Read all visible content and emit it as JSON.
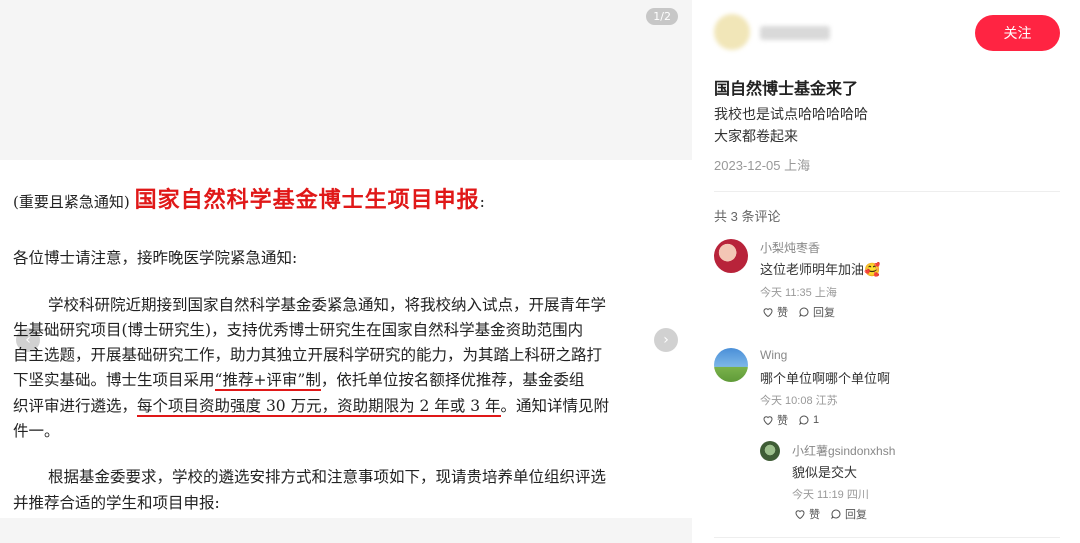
{
  "image_viewer": {
    "page_counter": "1/2",
    "prev_arrow": "‹",
    "next_arrow": "›"
  },
  "document": {
    "title_prefix": "(重要且紧急通知)",
    "title_main": "国家自然科学基金博士生项目申报",
    "title_suffix": ":",
    "greeting": "各位博士请注意，接昨晚医学院紧急通知:",
    "p1_line1": "学校科研院近期接到国家自然科学基金委紧急通知，将我校纳入试点，开展青年学",
    "p1_line2": "生基础研究项目(博士研究生)，支持优秀博士研究生在国家自然科学基金资助范围内",
    "p1_line3": "自主选题，开展基础研究工作，助力其独立开展科学研究的能力，为其踏上科研之路打",
    "p1_line4_a": "下坚实基础。博士生项目采用",
    "p1_line4_b": "“推荐+评审”制",
    "p1_line4_c": "，依托单位按名额择优推荐，基金委组",
    "p1_line5_a": "织评审进行遴选，",
    "p1_line5_b": "每个项目资助强度 30 万元，资助期限为 2 年或 3 年",
    "p1_line5_c": "。通知详情见附",
    "p1_line6": "件一。",
    "p2_line1": "根据基金委要求，学校的遴选安排方式和注意事项如下，现请贵培养单位组织评选",
    "p2_line2": "并推荐合适的学生和项目申报:"
  },
  "post": {
    "follow_label": "关注",
    "title": "国自然博士基金来了",
    "body_line1": "我校也是试点哈哈哈哈哈",
    "body_line2": "大家都卷起来",
    "meta": "2023-12-05 上海"
  },
  "comments": {
    "count_label": "共 3 条评论",
    "items": [
      {
        "user": "小梨炖枣香",
        "text": "这位老师明年加油🥰",
        "meta": "今天 11:35 上海",
        "like_label": "赞",
        "reply_label": "回复"
      },
      {
        "user": "Wing",
        "text": "哪个单位啊哪个单位啊",
        "meta": "今天 10:08 江苏",
        "like_label": "赞",
        "reply_label": "1"
      },
      {
        "user": "小红薯gsindonxhsh",
        "text": "貌似是交大",
        "meta": "今天 11:19 四川",
        "like_label": "赞",
        "reply_label": "回复"
      }
    ]
  },
  "colors": {
    "accent": "#ff2442",
    "doc_red": "#e01818"
  }
}
